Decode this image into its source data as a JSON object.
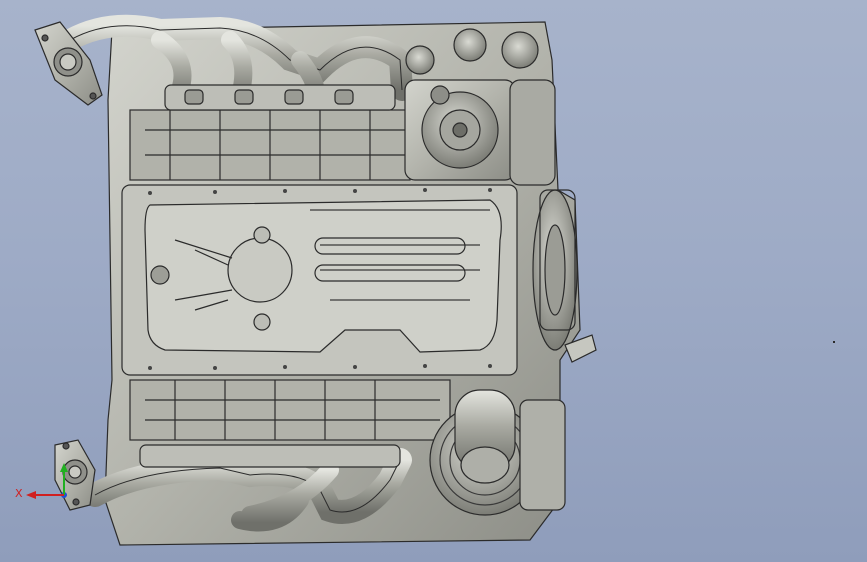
{
  "viewport": {
    "background_top": "#a7b3cb",
    "background_bottom": "#8f9dbb",
    "model_color": "#b7b8b1",
    "edge_color": "#2b2b2b"
  },
  "triad": {
    "x_label": "X",
    "x_color": "#d02020",
    "y_color": "#20b020",
    "z_color": "#2050d0"
  }
}
